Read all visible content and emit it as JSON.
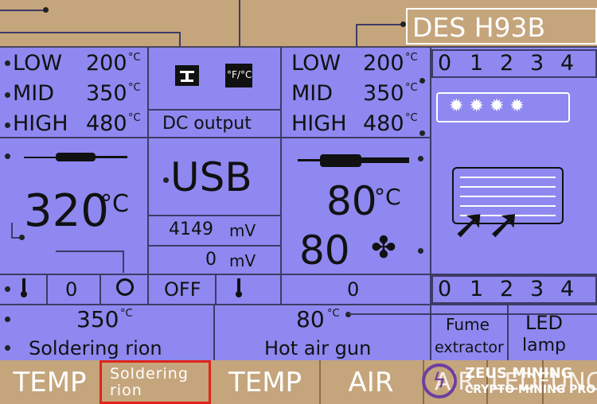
{
  "header": {
    "model": "DES  H93B"
  },
  "iron_presets": [
    {
      "label": "LOW",
      "value": "200",
      "unit": "°C"
    },
    {
      "label": "MID",
      "value": "350",
      "unit": "°C"
    },
    {
      "label": "HIGH",
      "value": "480",
      "unit": "°C"
    }
  ],
  "air_presets": [
    {
      "label": "LOW",
      "value": "200",
      "unit": "°C"
    },
    {
      "label": "MID",
      "value": "350",
      "unit": "°C"
    },
    {
      "label": "HIGH",
      "value": "480",
      "unit": "°C"
    }
  ],
  "dc": {
    "label": "DC output",
    "source": "USB",
    "voltage1": "4149",
    "voltage2": "0",
    "unit": "mV",
    "state": "OFF"
  },
  "iron": {
    "temp": "320",
    "unit": "°C",
    "level": "0",
    "set_temp": "350",
    "set_unit": "°C",
    "name": "Soldering rion"
  },
  "air": {
    "temp": "80",
    "unit": "°C",
    "fan": "80",
    "level": "0",
    "set_temp": "80",
    "set_unit": "°C",
    "name": "Hot air gun"
  },
  "levels_top": [
    "0",
    "1",
    "2",
    "3",
    "4"
  ],
  "levels_bottom": [
    "0",
    "1",
    "2",
    "3",
    "4"
  ],
  "fume": {
    "line1": "Fume",
    "line2": "extractor"
  },
  "led": {
    "line1": "LED",
    "line2": "lamp"
  },
  "unit_toggle": "°F/°C",
  "buttons": [
    "TEMP",
    "Soldering rion",
    "TEMP",
    "AIR",
    "AIR",
    "LED",
    "FUNC"
  ],
  "watermark": {
    "line1": "ZEUS MINING",
    "line2": "CRYPTO MINING PRO"
  },
  "colors": {
    "lcd": "#8e88f0",
    "frame": "#c5a57c",
    "highlight": "#e0251b"
  }
}
